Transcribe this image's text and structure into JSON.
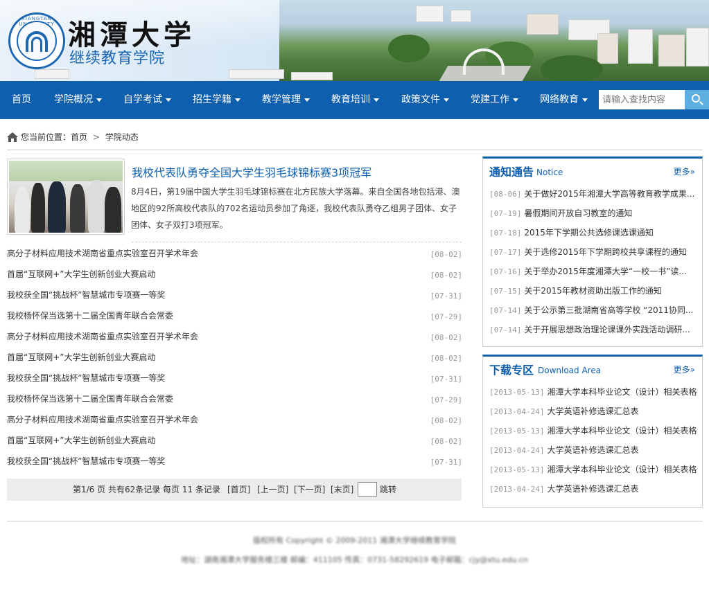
{
  "header": {
    "university_name": "湘潭大学",
    "college_name": "继续教育学院",
    "seal_text": "XIANGTAN UNIVERSITY"
  },
  "nav": {
    "items": [
      {
        "label": "首页",
        "has_dropdown": false
      },
      {
        "label": "学院概况",
        "has_dropdown": true
      },
      {
        "label": "自学考试",
        "has_dropdown": true
      },
      {
        "label": "招生学籍",
        "has_dropdown": true
      },
      {
        "label": "教学管理",
        "has_dropdown": true
      },
      {
        "label": "教育培训",
        "has_dropdown": true
      },
      {
        "label": "政策文件",
        "has_dropdown": true
      },
      {
        "label": "党建工作",
        "has_dropdown": true
      },
      {
        "label": "网络教育",
        "has_dropdown": true
      }
    ],
    "search_placeholder": "请输入查找内容",
    "search_icon": "search-icon"
  },
  "breadcrumb": {
    "prefix": "您当前位置：",
    "home": "首页",
    "separator": ">",
    "current": "学院动态"
  },
  "featured": {
    "title": "我校代表队勇夺全国大学生羽毛球锦标赛3项冠军",
    "description": "8月4日，第19届中国大学生羽毛球锦标赛在北方民族大学落幕。来自全国各地包括港、澳地区的92所高校代表队的702名运动员参加了角逐，我校代表队勇夺乙组男子团体、女子团体、女子双打3项冠军。"
  },
  "news": [
    {
      "title": "高分子材料应用技术湖南省重点实验室召开学术年会",
      "date": "[08-02]"
    },
    {
      "title": "首届“互联网+”大学生创新创业大赛启动",
      "date": "[08-02]"
    },
    {
      "title": "我校获全国“挑战杯”智慧城市专项赛一等奖",
      "date": "[07-31]"
    },
    {
      "title": "我校杨怀保当选第十二届全国青年联合会常委",
      "date": "[07-29]"
    },
    {
      "title": "高分子材料应用技术湖南省重点实验室召开学术年会",
      "date": "[08-02]"
    },
    {
      "title": "首届“互联网+”大学生创新创业大赛启动",
      "date": "[08-02]"
    },
    {
      "title": "我校获全国“挑战杯”智慧城市专项赛一等奖",
      "date": "[07-31]"
    },
    {
      "title": "我校杨怀保当选第十二届全国青年联合会常委",
      "date": "[07-29]"
    },
    {
      "title": "高分子材料应用技术湖南省重点实验室召开学术年会",
      "date": "[08-02]"
    },
    {
      "title": "首届“互联网+”大学生创新创业大赛启动",
      "date": "[08-02]"
    },
    {
      "title": "我校获全国“挑战杯”智慧城市专项赛一等奖",
      "date": "[07-31]"
    }
  ],
  "pager": {
    "summary": "第1/6 页 共有62条记录 每页 11 条记录",
    "first": "[首页]",
    "prev": "[上一页]",
    "next": "[下一页]",
    "last": "[末页]",
    "go": "跳转"
  },
  "notice": {
    "title_cn": "通知通告",
    "title_en": "Notice",
    "more": "更多»",
    "items": [
      {
        "date": "[08-06]",
        "title": "关于做好2015年湘潭大学高等教育教学成果..."
      },
      {
        "date": "[07-19]",
        "title": "暑假期间开放自习教室的通知"
      },
      {
        "date": "[07-18]",
        "title": "2015年下学期公共选修课选课通知"
      },
      {
        "date": "[07-17]",
        "title": "关于选修2015年下学期跨校共享课程的通知"
      },
      {
        "date": "[07-16]",
        "title": "关于举办2015年度湘潭大学“一校一书”读..."
      },
      {
        "date": "[07-15]",
        "title": "关于2015年教材资助出版工作的通知"
      },
      {
        "date": "[07-14]",
        "title": "关于公示第三批湖南省高等学校 “2011协同..."
      },
      {
        "date": "[07-14]",
        "title": "关于开展思想政治理论课课外实践活动调研..."
      }
    ]
  },
  "download": {
    "title_cn": "下载专区",
    "title_en": "Download Area",
    "more": "更多»",
    "items": [
      {
        "date": "[2013-05-13]",
        "title": "湘潭大学本科毕业论文（设计）相关表格"
      },
      {
        "date": "[2013-04-24]",
        "title": "大学英语补修选课汇总表"
      },
      {
        "date": "[2013-05-13]",
        "title": "湘潭大学本科毕业论文（设计）相关表格"
      },
      {
        "date": "[2013-04-24]",
        "title": "大学英语补修选课汇总表"
      },
      {
        "date": "[2013-05-13]",
        "title": "湘潭大学本科毕业论文（设计）相关表格"
      },
      {
        "date": "[2013-04-24]",
        "title": "大学英语补修选课汇总表"
      }
    ]
  },
  "footer": {
    "copyright": "版权所有 Copyright © 2009-2011 湘潭大学继续教育学院",
    "contact": "地址：湖南湘潭大学服务楼三楼 邮编：411105 传真：0731-58292619 电子邮箱：cjy@xtu.edu.cn"
  },
  "colors": {
    "nav_bg": "#0e5fae",
    "accent": "#0e5fae",
    "search_button": "#5eaee0"
  }
}
